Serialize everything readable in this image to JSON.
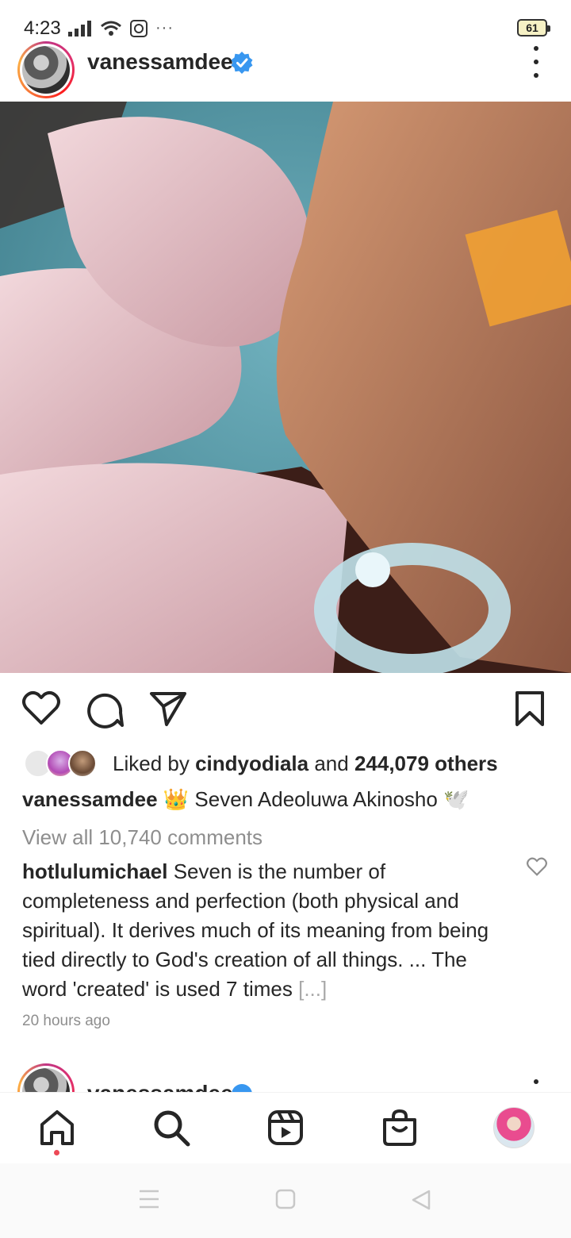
{
  "status_bar": {
    "time": "4:23",
    "more": "···",
    "battery": "61"
  },
  "post": {
    "username": "vanessamdee",
    "photo_alt": "",
    "likes": {
      "prefix": "Liked by ",
      "liker": "cindyodiala",
      "middle": " and ",
      "count": "244,079 others"
    },
    "caption": {
      "username": "vanessamdee",
      "crown": "👑",
      "text": " Seven Adeoluwa Akinosho ",
      "dove": "🕊️"
    },
    "view_comments": "View all 10,740 comments",
    "comment": {
      "username": "hotlulumichael",
      "text": " Seven is the number of completeness and perfection (both physical and spiritual). It derives much of its meaning from being tied directly to God's creation of all things. ... The word 'created' is used 7 times ",
      "more": "[...]"
    },
    "timestamp": "20 hours ago"
  },
  "next_post": {
    "username": "vanessamdee"
  },
  "icons": {
    "like": "heart-icon",
    "comment": "comment-bubble-icon",
    "share": "paper-plane-icon",
    "save": "bookmark-icon",
    "home": "home-icon",
    "search": "search-icon",
    "reels": "reels-icon",
    "shop": "shop-bag-icon"
  },
  "colors": {
    "verified": "#3897f0",
    "notification_dot": "#ed4956",
    "muted": "#8e8e8e"
  }
}
